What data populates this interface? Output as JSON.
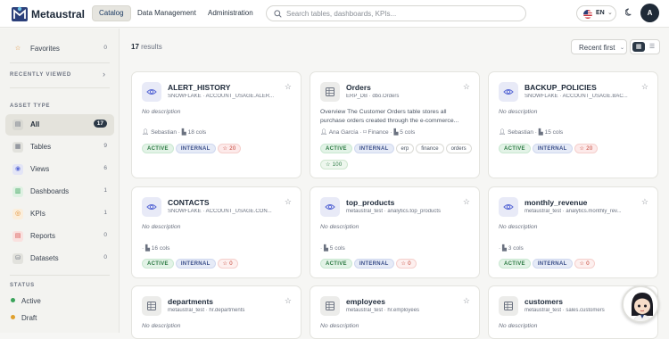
{
  "app": {
    "brand": "Metaustral",
    "user_initial": "A"
  },
  "nav": [
    {
      "label": "Catalog",
      "active": true
    },
    {
      "label": "Data Management",
      "active": false
    },
    {
      "label": "Administration",
      "active": false
    }
  ],
  "search": {
    "placeholder": "Search tables, dashboards, KPIs...",
    "value": ""
  },
  "language": {
    "code": "EN"
  },
  "sidebar": {
    "favorites": {
      "label": "Favorites",
      "count": "0"
    },
    "recently_viewed": "RECENTLY VIEWED",
    "asset_type_heading": "ASSET TYPE",
    "asset_types": [
      {
        "label": "All",
        "count": "17",
        "active": true,
        "icon": "document-icon",
        "color": "#6b7280"
      },
      {
        "label": "Tables",
        "count": "9",
        "icon": "table-icon",
        "color": "#6b7280"
      },
      {
        "label": "Views",
        "count": "6",
        "icon": "eye-icon",
        "color": "#5b6bd6"
      },
      {
        "label": "Dashboards",
        "count": "1",
        "icon": "dashboard-icon",
        "color": "#3aa35a"
      },
      {
        "label": "KPIs",
        "count": "1",
        "icon": "target-icon",
        "color": "#e08a2c"
      },
      {
        "label": "Reports",
        "count": "0",
        "icon": "report-icon",
        "color": "#d9534f"
      },
      {
        "label": "Datasets",
        "count": "0",
        "icon": "database-icon",
        "color": "#6b7280"
      }
    ],
    "status_heading": "STATUS",
    "statuses": [
      {
        "label": "Active",
        "color": "#3aa35a"
      },
      {
        "label": "Draft",
        "color": "#e0a02c"
      }
    ]
  },
  "toolbar": {
    "results_count": "17",
    "results_label": "results",
    "sort_label": "Recent first"
  },
  "cards": [
    {
      "title": "ALERT_HISTORY",
      "subtitle": "SNOWFLAKE · ACCOUNT_USAGE.ALER...",
      "icon": "eye-icon",
      "description": "No description",
      "has_description": false,
      "owner": "Sebastian",
      "domain": "",
      "cols": "18 cols",
      "tags": [],
      "status": "ACTIVE",
      "visibility": "INTERNAL",
      "heat": "20",
      "score": ""
    },
    {
      "title": "Orders",
      "subtitle": "ERP_DB · dbo.Orders",
      "icon": "table-icon",
      "description": "Overview The Customer Orders table stores all purchase orders created through the e-commerce...",
      "has_description": true,
      "owner": "Ana García",
      "domain": "Finance",
      "cols": "5 cols",
      "tags": [
        "erp",
        "finance",
        "orders"
      ],
      "status": "ACTIVE",
      "visibility": "INTERNAL",
      "heat": "",
      "score": "100"
    },
    {
      "title": "BACKUP_POLICIES",
      "subtitle": "SNOWFLAKE · ACCOUNT_USAGE.BAC...",
      "icon": "eye-icon",
      "description": "No description",
      "has_description": false,
      "owner": "Sebastian",
      "domain": "",
      "cols": "15 cols",
      "tags": [],
      "status": "ACTIVE",
      "visibility": "INTERNAL",
      "heat": "20",
      "score": ""
    },
    {
      "title": "CONTACTS",
      "subtitle": "SNOWFLAKE · ACCOUNT_USAGE.CON...",
      "icon": "eye-icon",
      "description": "No description",
      "has_description": false,
      "owner": "",
      "domain": "",
      "cols": "16 cols",
      "tags": [],
      "status": "ACTIVE",
      "visibility": "INTERNAL",
      "heat": "0",
      "score": ""
    },
    {
      "title": "top_products",
      "subtitle": "metaustral_test · analytics.top_products",
      "icon": "eye-icon",
      "description": "No description",
      "has_description": false,
      "owner": "",
      "domain": "",
      "cols": "5 cols",
      "tags": [],
      "status": "ACTIVE",
      "visibility": "INTERNAL",
      "heat": "0",
      "score": ""
    },
    {
      "title": "monthly_revenue",
      "subtitle": "metaustral_test · analytics.monthly_rev...",
      "icon": "eye-icon",
      "description": "No description",
      "has_description": false,
      "owner": "",
      "domain": "",
      "cols": "3 cols",
      "tags": [],
      "status": "ACTIVE",
      "visibility": "INTERNAL",
      "heat": "0",
      "score": ""
    },
    {
      "title": "departments",
      "subtitle": "metaustral_test · hr.departments",
      "icon": "table-icon",
      "description": "No description",
      "has_description": false
    },
    {
      "title": "employees",
      "subtitle": "metaustral_test · hr.employees",
      "icon": "table-icon",
      "description": "No description",
      "has_description": false
    },
    {
      "title": "customers",
      "subtitle": "metaustral_test · sales.customers",
      "icon": "table-icon",
      "description": "No description",
      "has_description": false
    }
  ]
}
